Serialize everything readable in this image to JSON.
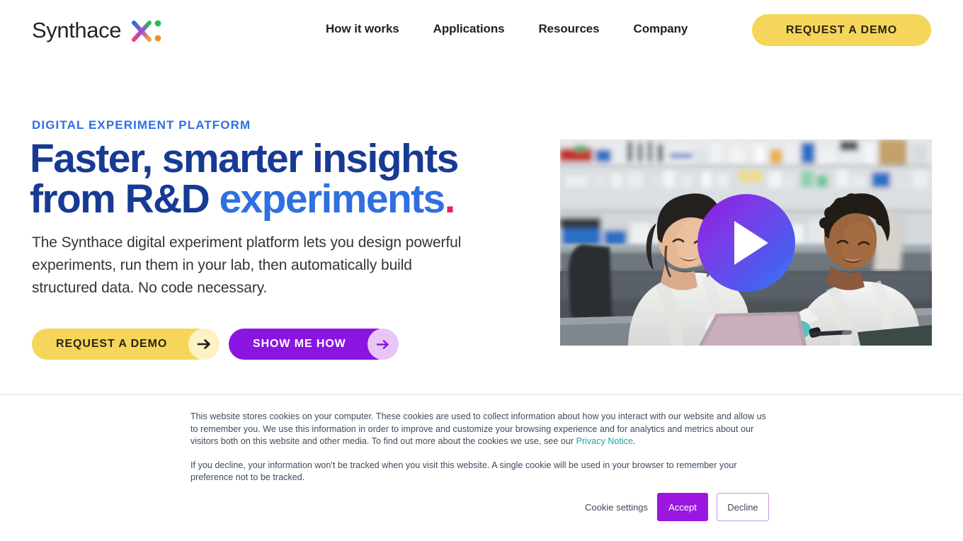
{
  "header": {
    "logo_word": "Synthace",
    "logo_mark_name": "synthace-x-mark",
    "nav": [
      {
        "label": "How it works"
      },
      {
        "label": "Applications"
      },
      {
        "label": "Resources"
      },
      {
        "label": "Company"
      }
    ],
    "cta_label": "REQUEST A DEMO"
  },
  "hero": {
    "eyebrow": "DIGITAL EXPERIMENT PLATFORM",
    "headline_line1": "Faster, smarter insights",
    "headline_line2_plain": "from R&D ",
    "headline_line2_accent": "experiments",
    "headline_dot": ".",
    "subcopy": "The Synthace digital experiment platform lets you design powerful experiments, run them in your lab, then automatically build structured data. No code necessary.",
    "primary_cta": "REQUEST A DEMO",
    "secondary_cta": "SHOW ME HOW",
    "video_alt": "Two scientists in white lab coats smiling at a laptop in a laboratory",
    "play_label": "play-button"
  },
  "cookie_banner": {
    "paragraph1_a": "This website stores cookies on your computer. These cookies are used to collect information about how you interact with our website and allow us to remember you. We use this information in order to improve and customize your browsing experience and for analytics and metrics about our visitors both on this website and other media. To find out more about the cookies we use, see our ",
    "privacy_link": "Privacy Notice",
    "paragraph1_b": ".",
    "paragraph2": "If you decline, your information won't be tracked when you visit this website. A single cookie will be used in your browser to remember your preference not to be tracked.",
    "settings_label": "Cookie settings",
    "accept_label": "Accept",
    "decline_label": "Decline"
  },
  "colors": {
    "brand_yellow": "#f5d65a",
    "brand_purple": "#8a15e0",
    "headline_navy": "#173a94",
    "accent_blue": "#2f6fe0",
    "accent_pink": "#e8245a",
    "cookie_link_teal": "#1fa3a8",
    "cookie_accept_purple": "#9b17e0"
  }
}
